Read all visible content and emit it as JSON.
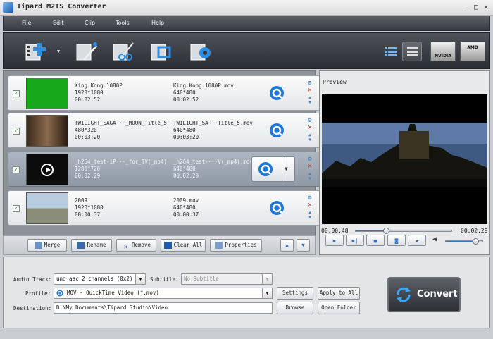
{
  "window": {
    "title": "Tipard M2TS Converter",
    "controls": [
      "_",
      "□",
      "✕"
    ]
  },
  "menu": [
    "File",
    "Edit",
    "Clip",
    "Tools",
    "Help"
  ],
  "toolbar": {
    "tools": [
      "add-file",
      "edit-effect",
      "clip",
      "3d-crop",
      "preferences"
    ],
    "view_list": "list-view",
    "view_detail": "detail-view",
    "nvidia": "NVIDIA",
    "amd": "AMD"
  },
  "files": [
    {
      "name": "King.Kong.1080P",
      "res": "1920*1080",
      "dur": "00:02:52",
      "out_name": "King.Kong.1080P.mov",
      "out_res": "640*480",
      "out_dur": "00:02:52",
      "selected": false
    },
    {
      "name": "TWILIGHT_SAGA···_MOON_Title_5",
      "res": "480*320",
      "dur": "00:03:20",
      "out_name": "TWILIGHT_SA···Title_5.mov",
      "out_res": "640*480",
      "out_dur": "00:03:20",
      "selected": false
    },
    {
      "name": "_h264_test-iP···_for_TV(_mp4)",
      "res": "1280*720",
      "dur": "00:02:29",
      "out_name": "_h264_test-···V(_mp4).mov",
      "out_res": "640*480",
      "out_dur": "00:02:29",
      "selected": true
    },
    {
      "name": "2009",
      "res": "1920*1080",
      "dur": "00:00:37",
      "out_name": "2009.mov",
      "out_res": "640*480",
      "out_dur": "00:00:37",
      "selected": false
    }
  ],
  "buttons": {
    "merge": "Merge",
    "rename": "Rename",
    "remove": "Remove",
    "clear_all": "Clear All",
    "properties": "Properties"
  },
  "preview": {
    "label": "Preview",
    "current_time": "00:00:48",
    "total_time": "00:02:29",
    "progress": 0.32,
    "volume": 0.8
  },
  "settings": {
    "audio_track_label": "Audio Track:",
    "audio_track": "und aac 2 channels (0x2)",
    "subtitle_label": "Subtitle:",
    "subtitle": "No Subtitle",
    "profile_label": "Profile:",
    "profile": "MOV - QuickTime Video (*.mov)",
    "settings_btn": "Settings",
    "apply_all_btn": "Apply to All",
    "destination_label": "Destination:",
    "destination": "D:\\My Documents\\Tipard Studio\\Video",
    "browse_btn": "Browse",
    "open_folder_btn": "Open Folder",
    "convert_btn": "Convert"
  },
  "colors": {
    "accent": "#1f6fd0",
    "toolbar": "#3a3e44",
    "selected_row": "#9aa3ae"
  }
}
